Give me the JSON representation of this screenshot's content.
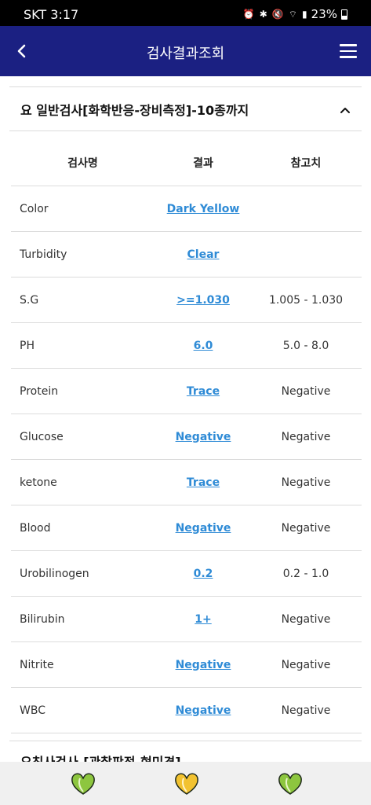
{
  "status_bar": {
    "carrier_time": "SKT 3:17",
    "battery_percent": "23%",
    "icons": [
      "alarm-icon",
      "bluetooth-icon",
      "mute-icon",
      "wifi-icon",
      "signal-icon",
      "battery-icon"
    ]
  },
  "app_bar": {
    "title": "검사결과조회",
    "back_icon": "chevron-left-icon",
    "menu_icon": "hamburger-menu-icon",
    "background_color": "#1b2082"
  },
  "section": {
    "title": "요 일반검사[화학반응-장비측정]-10종까지",
    "expanded": true
  },
  "table": {
    "headers": {
      "name": "검사명",
      "result": "결과",
      "reference": "참고치"
    },
    "rows": [
      {
        "name": "Color",
        "result": "Dark Yellow",
        "reference": ""
      },
      {
        "name": "Turbidity",
        "result": "Clear",
        "reference": ""
      },
      {
        "name": "S.G",
        "result": ">=1.030",
        "reference": "1.005 - 1.030"
      },
      {
        "name": "PH",
        "result": "6.0",
        "reference": "5.0 - 8.0"
      },
      {
        "name": "Protein",
        "result": "Trace",
        "reference": "Negative"
      },
      {
        "name": "Glucose",
        "result": "Negative",
        "reference": "Negative"
      },
      {
        "name": "ketone",
        "result": "Trace",
        "reference": "Negative"
      },
      {
        "name": "Blood",
        "result": "Negative",
        "reference": "Negative"
      },
      {
        "name": "Urobilinogen",
        "result": "0.2",
        "reference": "0.2 - 1.0"
      },
      {
        "name": "Bilirubin",
        "result": "1+",
        "reference": "Negative"
      },
      {
        "name": "Nitrite",
        "result": "Negative",
        "reference": "Negative"
      },
      {
        "name": "WBC",
        "result": "Negative",
        "reference": "Negative"
      }
    ],
    "link_color": "#2f8bd6"
  },
  "next_section": {
    "title": "요침사검사-[관찰판정-현미경]"
  },
  "bottom_nav": {
    "items": [
      {
        "icon": "heart-leaf-icon-green",
        "color": "#8dc63f"
      },
      {
        "icon": "heart-leaf-icon-yellow",
        "color": "#f2c230"
      },
      {
        "icon": "heart-leaf-icon-green",
        "color": "#8dc63f"
      }
    ]
  }
}
